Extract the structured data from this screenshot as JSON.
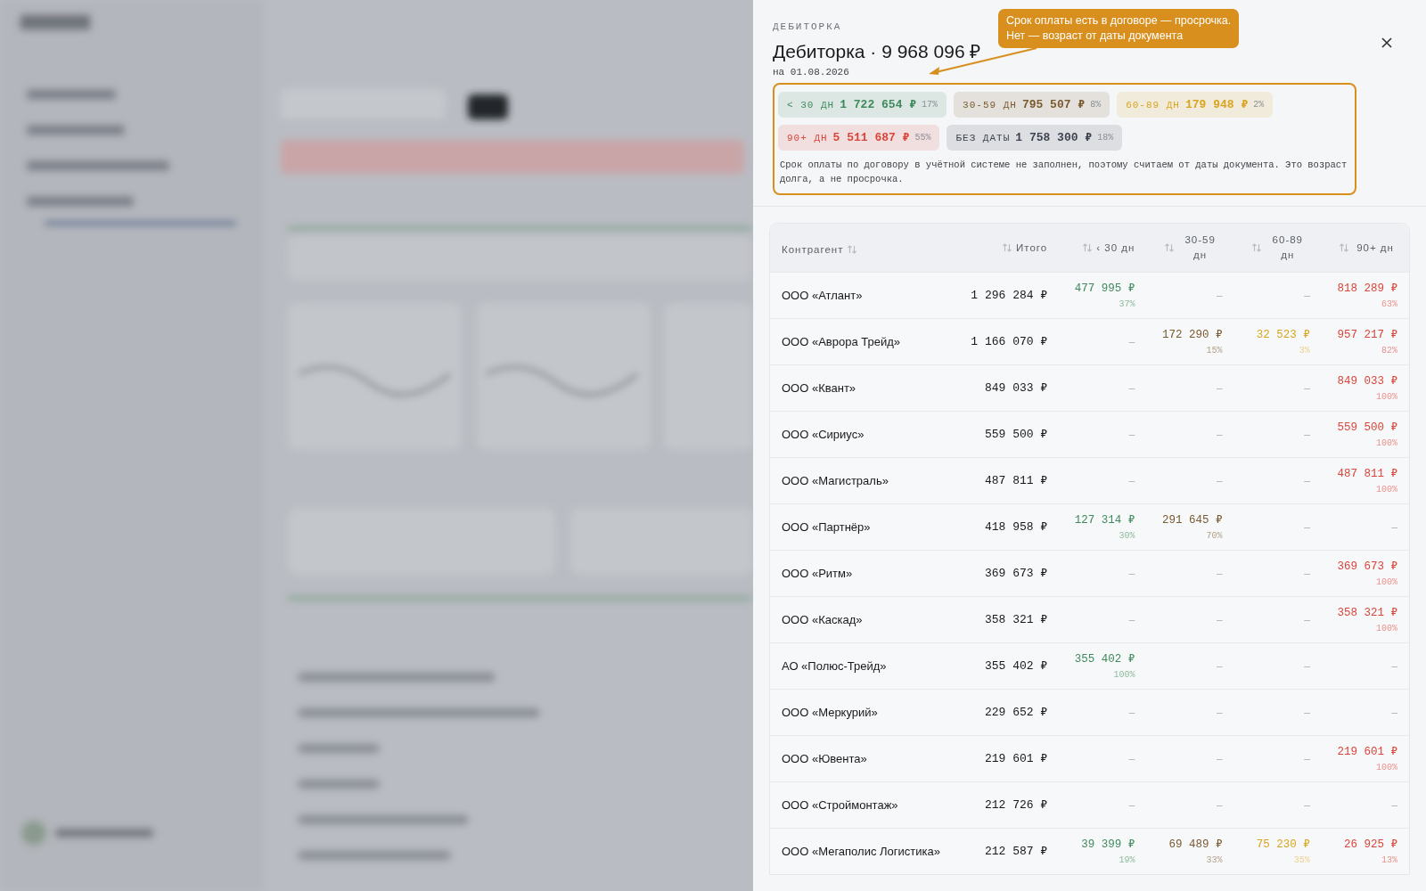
{
  "drawer": {
    "eyebrow": "ДЕБИТОРКА",
    "title": "Дебиторка · 9 968 096 ₽",
    "date": "на 01.08.2026",
    "callout": {
      "lines": [
        "Срок оплаты есть в договоре — просрочка.",
        "Нет — возраст от даты документа"
      ]
    },
    "chips": [
      {
        "label": "< 30 ДН",
        "amount": "1 722 654 ₽",
        "pct": "17%",
        "color": "#3f8a5c"
      },
      {
        "label": "30-59 ДН",
        "amount": "795 507 ₽",
        "pct": "8%",
        "color": "#7a5a2e"
      },
      {
        "label": "60-89 ДН",
        "amount": "179 948 ₽",
        "pct": "2%",
        "color": "#d9a520"
      },
      {
        "label": "90+ ДН",
        "amount": "5 511 687 ₽",
        "pct": "55%",
        "color": "#d9453a"
      },
      {
        "label": "БЕЗ ДАТЫ",
        "amount": "1 758 300 ₽",
        "pct": "18%",
        "color": "#3d4450"
      }
    ],
    "note": "Срок оплаты по договору в учётной системе не заполнен, поэтому считаем от даты документа. Это возраст долга, а не просрочка.",
    "table": {
      "columns": [
        "Контрагент",
        "Итого",
        "‹ 30 дн",
        "30-59 дн",
        "60-89 дн",
        "90+ дн"
      ],
      "rows": [
        {
          "name": "ООО «Атлант»",
          "total": "1 296 284 ₽",
          "buckets": [
            {
              "amount": "477 995 ₽",
              "pct": "37%"
            },
            {
              "dash": "—"
            },
            {
              "dash": "—"
            },
            {
              "amount": "818 289 ₽",
              "pct": "63%"
            }
          ]
        },
        {
          "name": "ООО «Аврора Трейд»",
          "total": "1 166 070 ₽",
          "buckets": [
            {
              "dash": "—"
            },
            {
              "amount": "172 290 ₽",
              "pct": "15%"
            },
            {
              "amount": "32 523 ₽",
              "pct": "3%"
            },
            {
              "amount": "957 217 ₽",
              "pct": "82%"
            }
          ]
        },
        {
          "name": "ООО «Квант»",
          "total": "849 033 ₽",
          "buckets": [
            {
              "dash": "—"
            },
            {
              "dash": "—"
            },
            {
              "dash": "—"
            },
            {
              "amount": "849 033 ₽",
              "pct": "100%"
            }
          ]
        },
        {
          "name": "ООО «Сириус»",
          "total": "559 500 ₽",
          "buckets": [
            {
              "dash": "—"
            },
            {
              "dash": "—"
            },
            {
              "dash": "—"
            },
            {
              "amount": "559 500 ₽",
              "pct": "100%"
            }
          ]
        },
        {
          "name": "ООО «Магистраль»",
          "total": "487 811 ₽",
          "buckets": [
            {
              "dash": "—"
            },
            {
              "dash": "—"
            },
            {
              "dash": "—"
            },
            {
              "amount": "487 811 ₽",
              "pct": "100%"
            }
          ]
        },
        {
          "name": "ООО «Партнёр»",
          "total": "418 958 ₽",
          "buckets": [
            {
              "amount": "127 314 ₽",
              "pct": "30%"
            },
            {
              "amount": "291 645 ₽",
              "pct": "70%"
            },
            {
              "dash": "—"
            },
            {
              "dash": "—"
            }
          ]
        },
        {
          "name": "ООО «Ритм»",
          "total": "369 673 ₽",
          "buckets": [
            {
              "dash": "—"
            },
            {
              "dash": "—"
            },
            {
              "dash": "—"
            },
            {
              "amount": "369 673 ₽",
              "pct": "100%"
            }
          ]
        },
        {
          "name": "ООО «Каскад»",
          "total": "358 321 ₽",
          "buckets": [
            {
              "dash": "—"
            },
            {
              "dash": "—"
            },
            {
              "dash": "—"
            },
            {
              "amount": "358 321 ₽",
              "pct": "100%"
            }
          ]
        },
        {
          "name": "АО «Полюс-Трейд»",
          "total": "355 402 ₽",
          "buckets": [
            {
              "amount": "355 402 ₽",
              "pct": "100%"
            },
            {
              "dash": "—"
            },
            {
              "dash": "—"
            },
            {
              "dash": "—"
            }
          ]
        },
        {
          "name": "ООО «Меркурий»",
          "total": "229 652 ₽",
          "buckets": [
            {
              "dash": "—"
            },
            {
              "dash": "—"
            },
            {
              "dash": "—"
            },
            {
              "dash": "—"
            }
          ]
        },
        {
          "name": "ООО «Ювента»",
          "total": "219 601 ₽",
          "buckets": [
            {
              "dash": "—"
            },
            {
              "dash": "—"
            },
            {
              "dash": "—"
            },
            {
              "amount": "219 601 ₽",
              "pct": "100%"
            }
          ]
        },
        {
          "name": "ООО «Строймонтаж»",
          "total": "212 726 ₽",
          "buckets": [
            {
              "dash": "—"
            },
            {
              "dash": "—"
            },
            {
              "dash": "—"
            },
            {
              "dash": "—"
            }
          ]
        },
        {
          "name": "ООО «Мегаполис Логистика»",
          "total": "212 587 ₽",
          "buckets": [
            {
              "amount": "39 399 ₽",
              "pct": "19%"
            },
            {
              "amount": "69 489 ₽",
              "pct": "33%"
            },
            {
              "amount": "75 230 ₽",
              "pct": "35%"
            },
            {
              "amount": "26 925 ₽",
              "pct": "13%"
            }
          ]
        }
      ]
    }
  }
}
